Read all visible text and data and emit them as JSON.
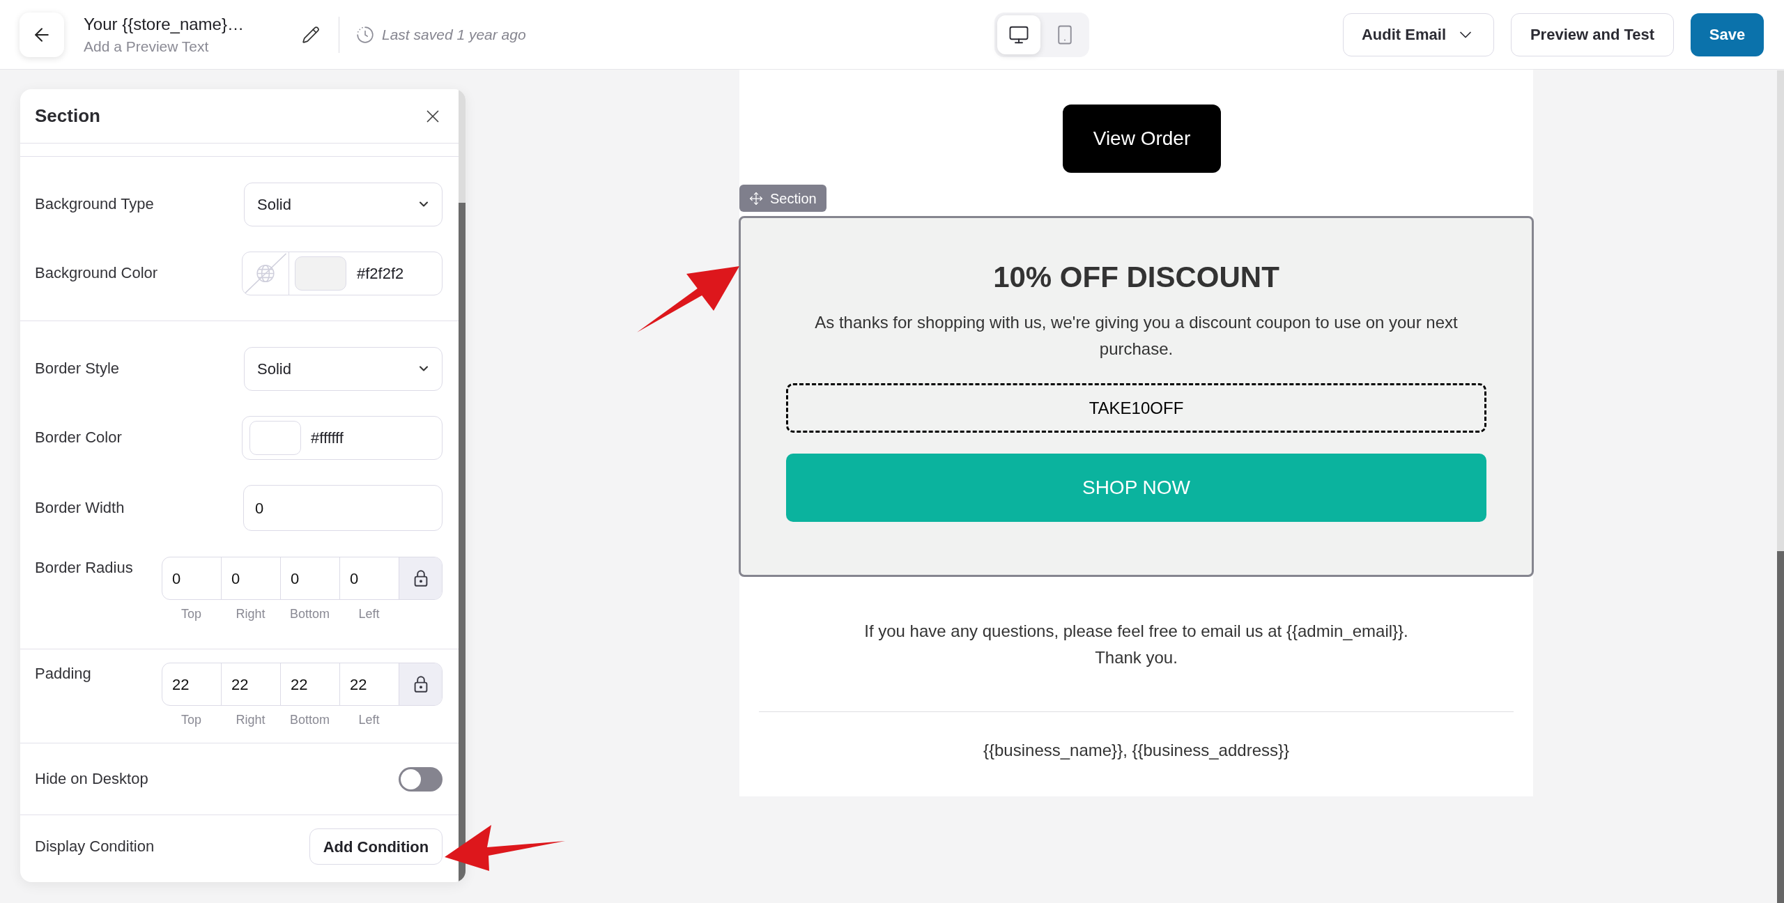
{
  "topbar": {
    "title": "Your {{store_name}…",
    "subtitle": "Add a Preview Text",
    "saved_status": "Last saved 1 year ago",
    "devices": [
      {
        "kind": "desktop",
        "selected": true
      },
      {
        "kind": "mobile",
        "selected": false
      }
    ],
    "actions": [
      {
        "kind": "dropdown",
        "label": "Audit Email"
      },
      {
        "kind": "secondary",
        "label": "Preview and Test"
      },
      {
        "kind": "primary",
        "label": "Save"
      }
    ]
  },
  "panel": {
    "title": "Section",
    "groups": [
      {
        "fields": [
          {
            "kind": "select",
            "label": "Background Type",
            "value": "Solid"
          },
          {
            "kind": "color",
            "label": "Background Color",
            "value": "#f2f2f2",
            "color": "#f2f2f2",
            "clearable": true
          }
        ]
      },
      {
        "fields": [
          {
            "kind": "select",
            "label": "Border Style",
            "value": "Solid"
          },
          {
            "kind": "color",
            "label": "Border Color",
            "value": "#ffffff",
            "color": "#ffffff",
            "clearable": false
          },
          {
            "kind": "number",
            "label": "Border Width",
            "value": "0"
          },
          {
            "kind": "sides",
            "label": "Border Radius",
            "sides": [
              {
                "label": "Top",
                "value": "0"
              },
              {
                "label": "Right",
                "value": "0"
              },
              {
                "label": "Bottom",
                "value": "0"
              },
              {
                "label": "Left",
                "value": "0"
              }
            ]
          }
        ]
      },
      {
        "fields": [
          {
            "kind": "sides",
            "label": "Padding",
            "sides": [
              {
                "label": "Top",
                "value": "22"
              },
              {
                "label": "Right",
                "value": "22"
              },
              {
                "label": "Bottom",
                "value": "22"
              },
              {
                "label": "Left",
                "value": "22"
              }
            ]
          }
        ]
      },
      {
        "fields": [
          {
            "kind": "toggle",
            "label": "Hide on Desktop",
            "on": false
          }
        ]
      },
      {
        "fields": [
          {
            "kind": "button",
            "label": "Display Condition",
            "button": "Add Condition"
          }
        ]
      }
    ]
  },
  "email": {
    "button": "View Order",
    "section": {
      "selected": true,
      "tag": "Section",
      "title": "10% OFF DISCOUNT",
      "text": "As thanks for shopping with us, we're giving you a discount coupon to use on your next purchase.",
      "coupon": "TAKE10OFF",
      "cta": "SHOP NOW"
    },
    "footer": {
      "lines": [
        "If you have any questions, please feel free to email us at {{admin_email}}.",
        "Thank you."
      ],
      "address": "{{business_name}}, {{business_address}}"
    }
  }
}
